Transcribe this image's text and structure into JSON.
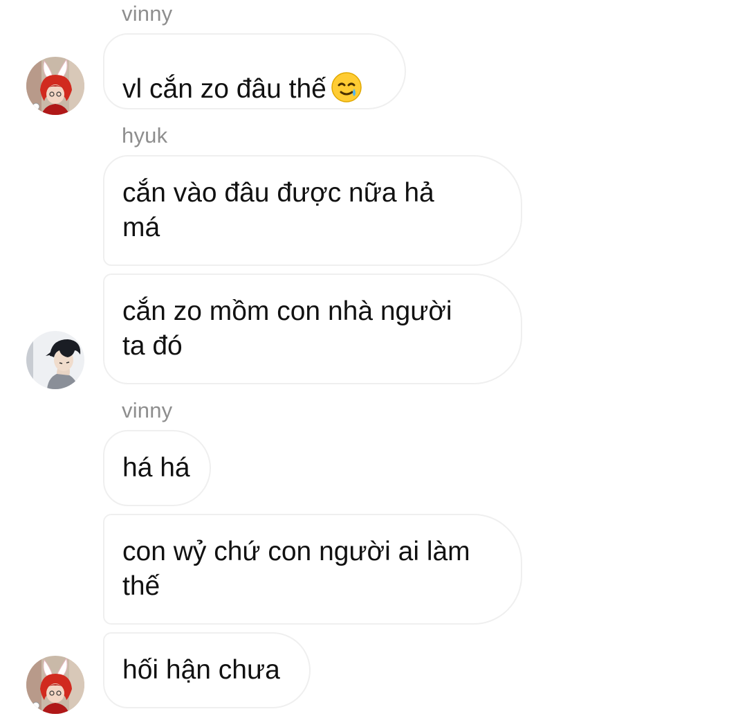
{
  "conversation": {
    "groups": [
      {
        "sender": "vinny",
        "messages": [
          {
            "text": "vl cắn zo đâu thế",
            "emoji": "smiling-face-with-tear"
          }
        ],
        "avatar": "red-hair-bunny-ears-avatar"
      },
      {
        "sender": "hyuk",
        "messages": [
          {
            "text": "cắn vào đâu được nữa hả\nmá"
          },
          {
            "text": "cắn zo mồm con nhà người\nta đó"
          }
        ],
        "avatar": "dark-hair-manhwa-avatar"
      },
      {
        "sender": "vinny",
        "messages": [
          {
            "text": "há há"
          },
          {
            "text": "con wỷ chứ con người ai làm\nthế"
          },
          {
            "text": "hối hận chưa"
          }
        ],
        "avatar": "red-hair-bunny-ears-avatar"
      }
    ]
  },
  "colors": {
    "sender_name": "#8e8e8e",
    "bubble_border": "#efefef",
    "text": "#111111",
    "background": "#ffffff"
  }
}
